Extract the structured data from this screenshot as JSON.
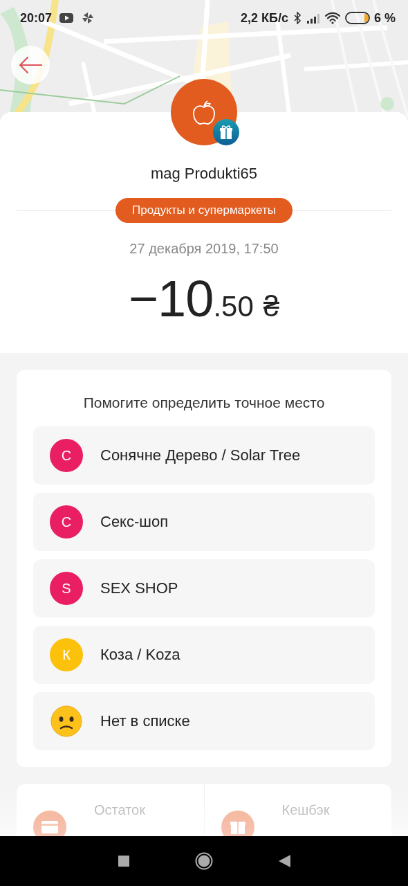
{
  "status_bar": {
    "time": "20:07",
    "network_speed": "2,2 КБ/с",
    "battery": "6 %"
  },
  "merchant": {
    "name": "mag Produkti65",
    "category": "Продукты и супермаркеты"
  },
  "transaction": {
    "date": "27 декабря 2019, 17:50",
    "amount_integer": "−10",
    "amount_fraction": ".50",
    "currency": "₴"
  },
  "place_prompt": {
    "title": "Помогите определить точное место",
    "options": [
      {
        "kind": "letter",
        "letter": "С",
        "name": "Сонячне Дерево / Solar Tree",
        "color": "#e91e63"
      },
      {
        "kind": "letter",
        "letter": "С",
        "name": "Секс-шоп",
        "color": "#e91e63"
      },
      {
        "kind": "letter",
        "letter": "S",
        "name": "SEX SHOP",
        "color": "#e91e63"
      },
      {
        "kind": "letter",
        "letter": "К",
        "name": "Коза / Koza",
        "color": "#fcc10a"
      },
      {
        "kind": "emoji",
        "name": "Нет в списке"
      }
    ]
  },
  "summary": [
    {
      "kind": "balance",
      "label": "Остаток"
    },
    {
      "kind": "cashback",
      "label": "Кешбэк"
    }
  ]
}
